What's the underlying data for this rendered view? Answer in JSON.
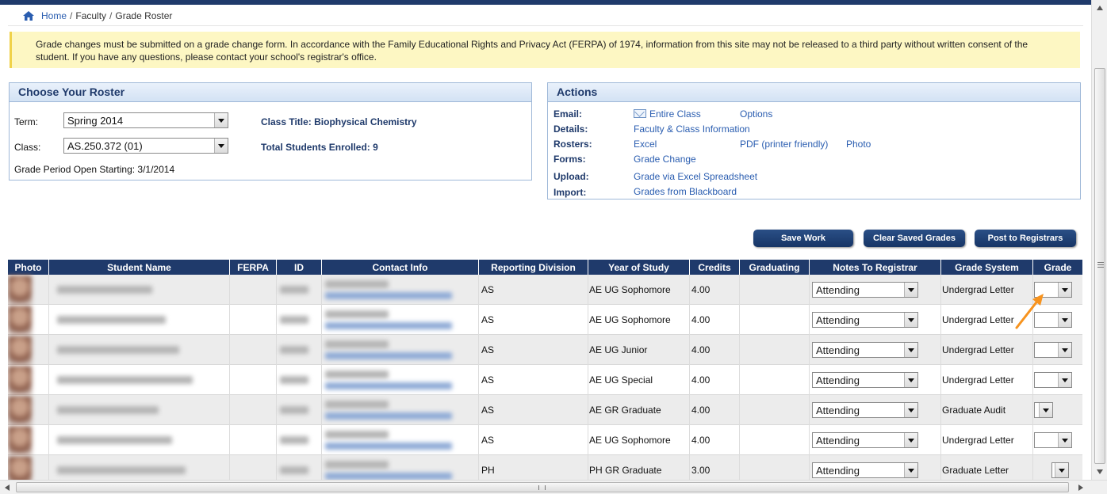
{
  "breadcrumb": {
    "home": "Home",
    "sep1": "/",
    "faculty": "Faculty",
    "sep2": "/",
    "current": "Grade Roster"
  },
  "notice": "Grade changes must be submitted on a grade change form. In accordance with the Family Educational Rights and Privacy Act (FERPA) of 1974, information from this site may not be released to a third party without written consent of the student. If you have any questions, please contact your school's registrar's office.",
  "roster": {
    "title": "Choose Your Roster",
    "term_label": "Term:",
    "term_value": "Spring 2014",
    "class_label": "Class:",
    "class_value": "AS.250.372 (01)",
    "class_title": "Class Title: Biophysical Chemistry",
    "total_enrolled": "Total Students Enrolled: 9",
    "grade_period": "Grade Period Open Starting: 3/1/2014"
  },
  "actions": {
    "title": "Actions",
    "email_label": "Email:",
    "email_entire": "Entire Class",
    "email_options": "Options",
    "details_label": "Details:",
    "details_link": "Faculty & Class Information",
    "rosters_label": "Rosters:",
    "rosters_excel": "Excel",
    "rosters_pdf": "PDF (printer friendly)",
    "rosters_photo": "Photo",
    "forms_label": "Forms:",
    "forms_link": "Grade Change",
    "upload_label": "Upload:",
    "upload_link": "Grade via Excel Spreadsheet",
    "import_label": "Import:",
    "import_link": "Grades from Blackboard"
  },
  "buttons": {
    "save": "Save Work",
    "clear": "Clear Saved Grades",
    "post": "Post to Registrars"
  },
  "columns": [
    "Photo",
    "Student Name",
    "FERPA",
    "ID",
    "Contact Info",
    "Reporting Division",
    "Year of Study",
    "Credits",
    "Graduating",
    "Notes To Registrar",
    "Grade System",
    "Grade"
  ],
  "rows": [
    {
      "division": "AS",
      "year": "AE UG Sophomore",
      "credits": "4.00",
      "notes": "Attending",
      "system": "Undergrad Letter"
    },
    {
      "division": "AS",
      "year": "AE UG Sophomore",
      "credits": "4.00",
      "notes": "Attending",
      "system": "Undergrad Letter"
    },
    {
      "division": "AS",
      "year": "AE UG Junior",
      "credits": "4.00",
      "notes": "Attending",
      "system": "Undergrad Letter"
    },
    {
      "division": "AS",
      "year": "AE UG Special",
      "credits": "4.00",
      "notes": "Attending",
      "system": "Undergrad Letter"
    },
    {
      "division": "AS",
      "year": "AE GR Graduate",
      "credits": "4.00",
      "notes": "Attending",
      "system": "Graduate Audit"
    },
    {
      "division": "AS",
      "year": "AE UG Sophomore",
      "credits": "4.00",
      "notes": "Attending",
      "system": "Undergrad Letter"
    },
    {
      "division": "PH",
      "year": "PH GR Graduate",
      "credits": "3.00",
      "notes": "Attending",
      "system": "Graduate Letter"
    }
  ],
  "colors": {
    "header": "#1f3a6b",
    "link": "#2a5db0",
    "notice_bg": "#fdf7c3",
    "annotation_arrow": "#f7931e"
  },
  "icons": {
    "home": "home-icon",
    "mail": "mail-icon",
    "dropdown": "chevron-down-icon"
  }
}
